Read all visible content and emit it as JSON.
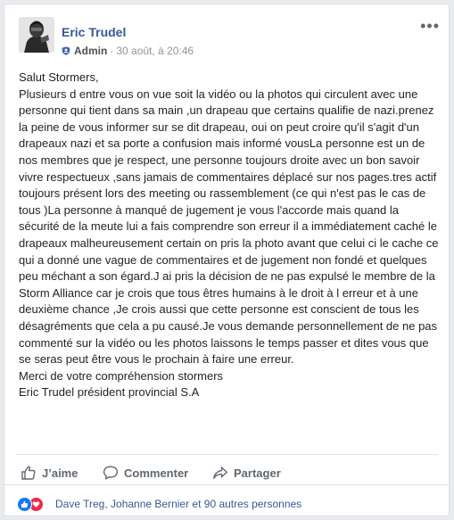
{
  "post": {
    "author": "Eric Trudel",
    "role": "Admin",
    "separator": "·",
    "timestamp": "30 août, à 20:46",
    "paragraphs": [
      "Salut Stormers,",
      "Plusieurs d entre vous on vue soit la vidéo ou la photos qui circulent avec une personne qui tient dans sa main ,un drapeau que certains qualifie de nazi.prenez la peine de vous informer sur se dit drapeau, oui on peut croire qu'il s'agit d'un drapeaux nazi et sa porte a confusion mais informé vousLa personne est un de nos membres que je respect, une personne toujours droite avec un bon savoir vivre respectueux ,sans jamais de commentaires déplacé sur nos pages.tres actif toujours présent lors des meeting ou rassemblement (ce qui n'est pas le cas de tous )La personne à manqué de jugement je vous l'accorde mais quand la sécurité de la meute lui a fais comprendre son erreur il a immédiatement caché le drapeaux malheureusement certain on pris la photo avant que celui ci le cache ce qui a donné une vague de commentaires et de jugement non fondé et quelques peu méchant a son égard.J ai pris la décision de ne pas expulsé le membre de la Storm Alliance car je crois que tous êtres humains à le droit à l erreur et à une deuxième chance ,Je crois aussi que cette personne est conscient de tous les désagréments que cela a pu causé.Je vous demande personnellement de ne pas commenté sur la vidéo ou les photos laissons le temps passer et dites vous que se seras peut être vous le prochain à faire une erreur.",
      "Merci de votre compréhension stormers",
      "Eric Trudel président provincial S.A"
    ]
  },
  "actions": {
    "like": "J’aime",
    "comment": "Commenter",
    "share": "Partager"
  },
  "reactions": {
    "icons": [
      "like-icon",
      "love-icon"
    ],
    "summary": "Dave Treg, Johanne Bernier et 90 autres personnes"
  },
  "colors": {
    "link": "#365899",
    "like_blue": "#1877f2",
    "love_red": "#f0284a",
    "text": "#1d2129",
    "muted": "#90949c"
  }
}
